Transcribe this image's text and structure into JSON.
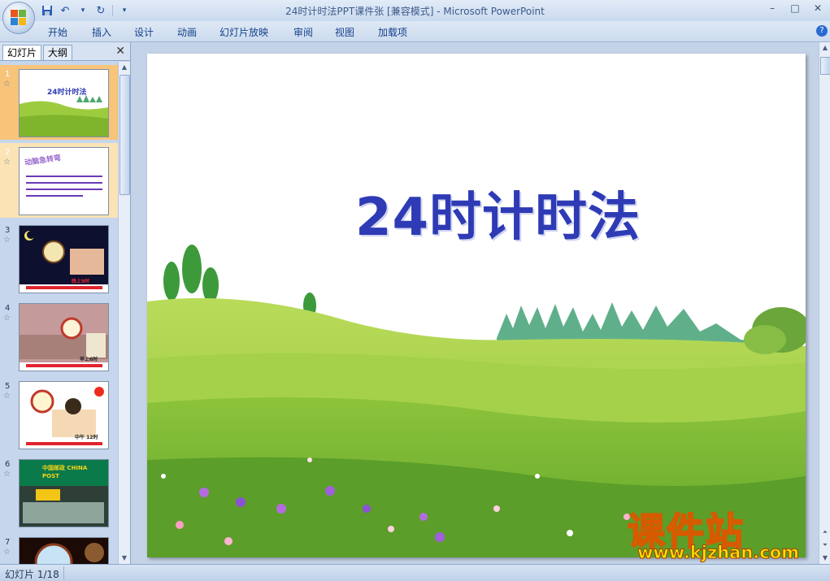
{
  "window": {
    "title": "24时计时法PPT课件张 [兼容模式] - Microsoft PowerPoint",
    "controls": [
      "–",
      "□",
      "✕"
    ]
  },
  "qat": {
    "save_icon": "save-icon",
    "undo_icon": "undo-icon",
    "redo_icon": "redo-icon",
    "more": "▾"
  },
  "ribbon": {
    "tabs": [
      "开始",
      "插入",
      "设计",
      "动画",
      "幻灯片放映",
      "审阅",
      "视图",
      "加载项"
    ],
    "help": "?"
  },
  "left_panel": {
    "tabs": [
      "幻灯片",
      "大纲"
    ],
    "close": "✕",
    "thumbs": [
      {
        "num": "1",
        "title": "24时计时法"
      },
      {
        "num": "2",
        "title": "动脑急转弯"
      },
      {
        "num": "3",
        "title": "晚上9时"
      },
      {
        "num": "4",
        "title": "早上6时"
      },
      {
        "num": "5",
        "title": "中午 12时"
      },
      {
        "num": "6",
        "title": "中国邮政 CHINA POST"
      },
      {
        "num": "7",
        "title": ""
      }
    ]
  },
  "slide": {
    "title": "24时计时法"
  },
  "watermark": {
    "big": "课件站",
    "url": "www.kjzhan.com"
  },
  "status": {
    "text": "幻灯片 1/18"
  },
  "colors": {
    "accent": "#2e3bb5",
    "ribbon_bg": "#dfe9f5",
    "selection": "#f7c47a"
  }
}
